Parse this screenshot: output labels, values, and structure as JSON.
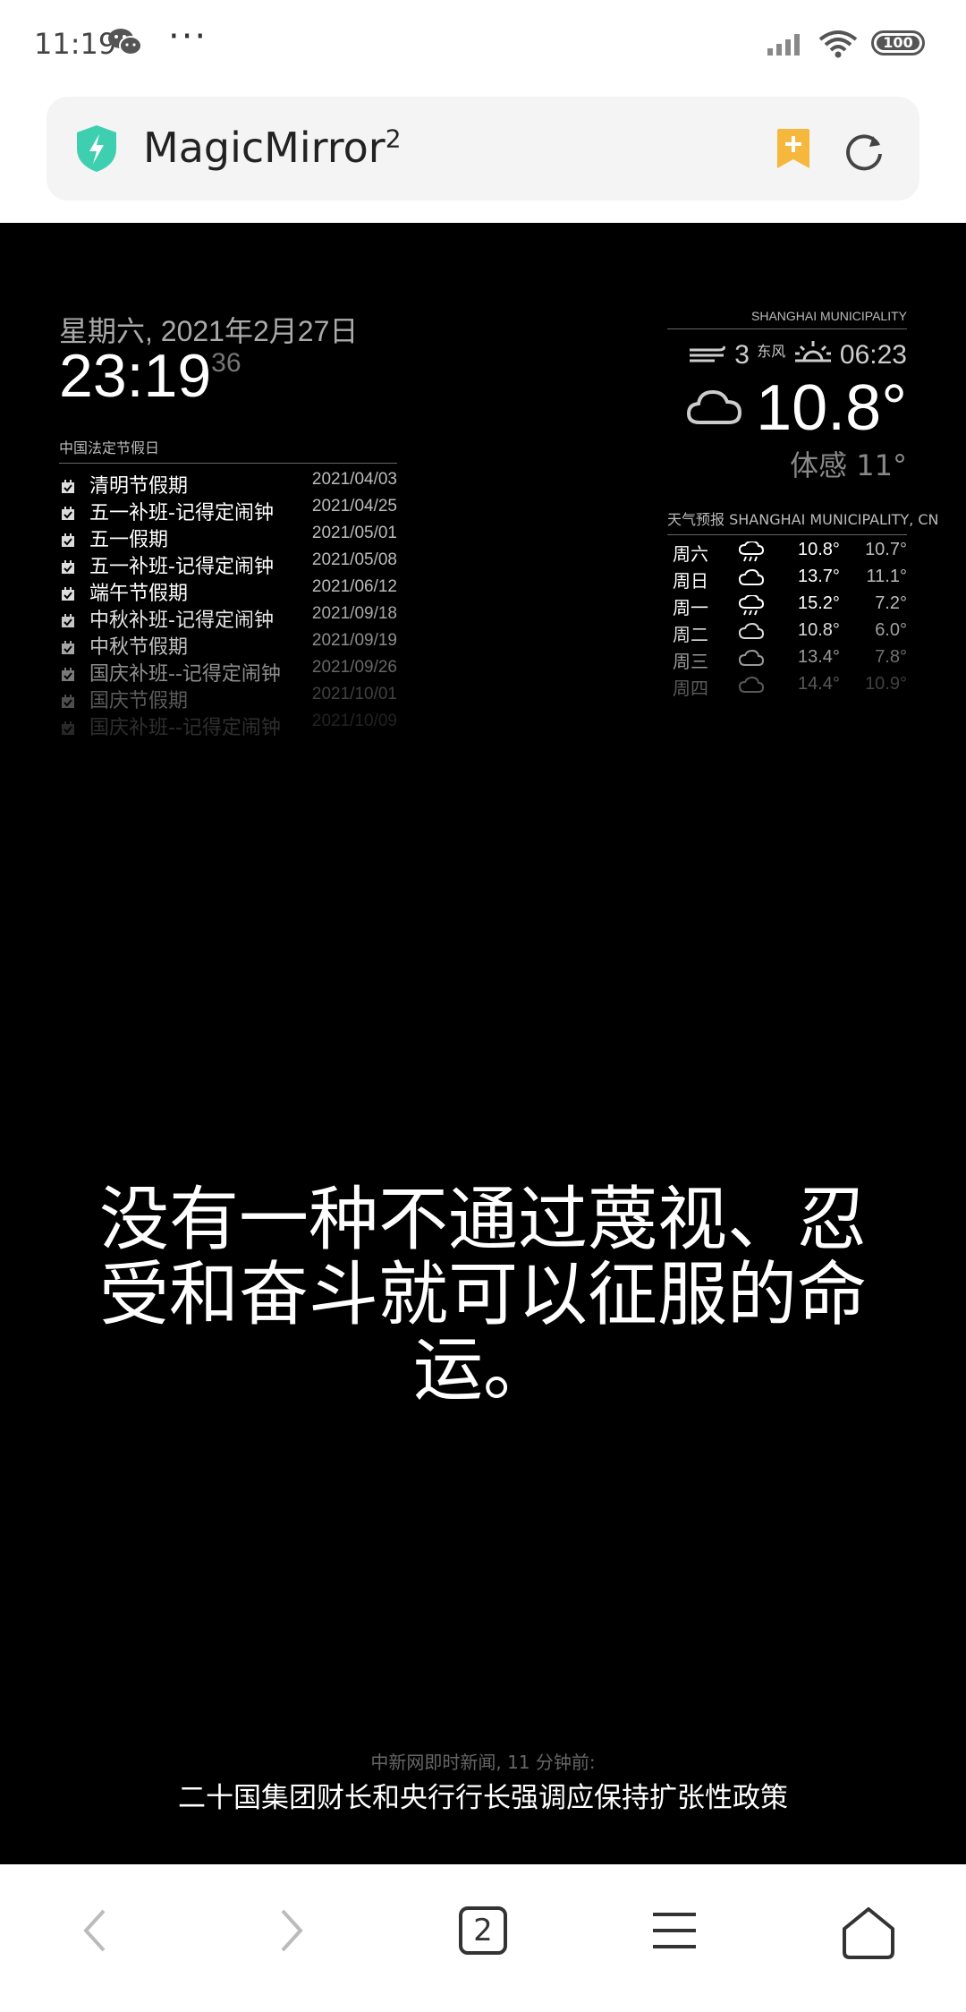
{
  "status_bar": {
    "time": "11:19",
    "dots": "···",
    "battery": "100"
  },
  "url_bar": {
    "title": "MagicMirror",
    "title_sup": "2"
  },
  "mirror": {
    "clock": {
      "date": "星期六, 2021年2月27日",
      "time": "23:19",
      "seconds": "36"
    },
    "holidays": {
      "header": "中国法定节假日",
      "items": [
        {
          "title": "清明节假期",
          "date": "2021/04/03"
        },
        {
          "title": "五一补班-记得定闹钟",
          "date": "2021/04/25"
        },
        {
          "title": "五一假期",
          "date": "2021/05/01"
        },
        {
          "title": "五一补班-记得定闹钟",
          "date": "2021/05/08"
        },
        {
          "title": "端午节假期",
          "date": "2021/06/12"
        },
        {
          "title": "中秋补班-记得定闹钟",
          "date": "2021/09/18"
        },
        {
          "title": "中秋节假期",
          "date": "2021/09/19"
        },
        {
          "title": "国庆补班--记得定闹钟",
          "date": "2021/09/26"
        },
        {
          "title": "国庆节假期",
          "date": "2021/10/01"
        },
        {
          "title": "国庆补班--记得定闹钟",
          "date": "2021/10/09"
        }
      ]
    },
    "weather": {
      "location": "SHANGHAI MUNICIPALITY",
      "wind_speed": "3",
      "wind_dir": "东风",
      "sunrise": "06:23",
      "temperature": "10.8°",
      "feels_like": "体感 11°"
    },
    "forecast": {
      "header": "天气预报 SHANGHAI MUNICIPALITY, CN",
      "rows": [
        {
          "day": "周六",
          "icon": "rain-cloud-icon",
          "max": "10.8°",
          "min": "10.7°"
        },
        {
          "day": "周日",
          "icon": "cloud-icon",
          "max": "13.7°",
          "min": "11.1°"
        },
        {
          "day": "周一",
          "icon": "rain-cloud-icon",
          "max": "15.2°",
          "min": "7.2°"
        },
        {
          "day": "周二",
          "icon": "cloud-icon",
          "max": "10.8°",
          "min": "6.0°"
        },
        {
          "day": "周三",
          "icon": "cloud-icon",
          "max": "13.4°",
          "min": "7.8°"
        },
        {
          "day": "周四",
          "icon": "cloud-icon",
          "max": "14.4°",
          "min": "10.9°"
        }
      ]
    },
    "quote": {
      "line1": "没有一种不通过蔑视、忍",
      "line2": "受和奋斗就可以征服的命",
      "line3": "运。"
    },
    "news": {
      "source": "中新网即时新闻, 11 分钟前:",
      "title": "二十国集团财长和央行行长强调应保持扩张性政策"
    }
  },
  "bottom_nav": {
    "tab_count": "2"
  },
  "colors": {
    "bookmark_accent": "#f5b83d",
    "shield_accent": "#3ecfb0",
    "mirror_background": "#000000"
  }
}
